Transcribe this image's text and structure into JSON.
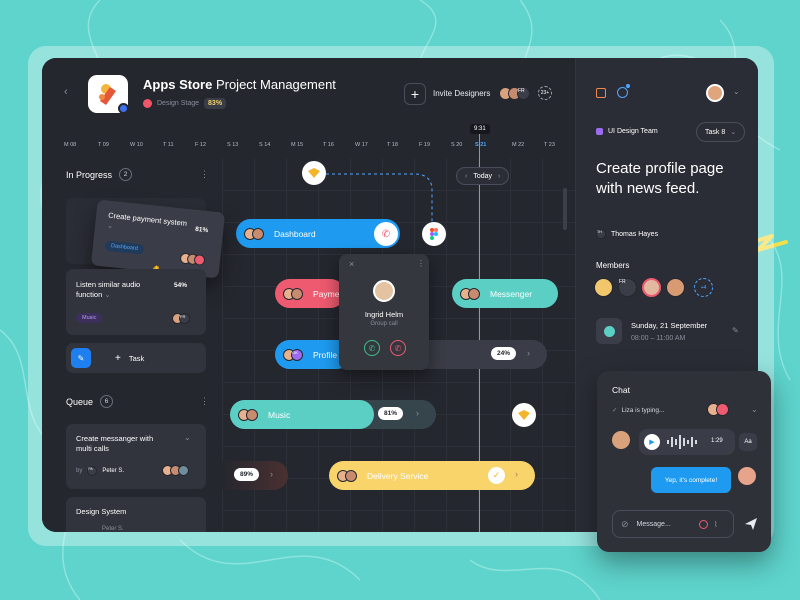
{
  "header": {
    "title_bold": "Apps Store",
    "title_rest": " Project Management",
    "stage_label": "Design Stage",
    "stage_pct": "83%",
    "invite_label": "Invite Designers",
    "invite_initials": "FR",
    "invite_more": "23+"
  },
  "timeline": {
    "days": [
      "M 08",
      "T 09",
      "W 10",
      "T 11",
      "F 12",
      "S 13",
      "S 14",
      "M 15",
      "T 16",
      "W 17",
      "T 18",
      "F 19",
      "S 20",
      "S 21",
      "M 22",
      "T 23"
    ],
    "now_time": "9:31",
    "today_label": "Today"
  },
  "in_progress": {
    "title": "In Progress",
    "count": "2",
    "card1": {
      "title": "Create payment system",
      "tag": "Dashboard",
      "pct": "81%"
    },
    "card2": {
      "title": "Listen similar audio function",
      "tag": "Music",
      "pct": "54%",
      "initials": "FR"
    },
    "task_label": "Task"
  },
  "queue": {
    "title": "Queue",
    "count": "6",
    "card1": {
      "title": "Create messanger with multi calls",
      "by": "by",
      "author": "Peter S.",
      "initials": "PA"
    },
    "card2": {
      "title": "Design System",
      "author": "Peter S."
    }
  },
  "bars": {
    "dashboard": "Dashboard",
    "payment": "Payme",
    "messenger": "Messenger",
    "profile": "Profile",
    "profile_initials": "OK",
    "profile_pct": "24%",
    "music": "Music",
    "music_pct": "81%",
    "delivery": "Delivery Service",
    "left_pct": "89%"
  },
  "call_popup": {
    "name": "Ingrid Helm",
    "subtitle": "Group call"
  },
  "sidebar": {
    "team": "UI Design Team",
    "task": "Task 8",
    "title": "Create profile page with news feed.",
    "author_initials": "TH",
    "author": "Thomas Hayes",
    "members_label": "Members",
    "member_initials": "FR",
    "member_more": "+4",
    "event_date": "Sunday, 21 September",
    "event_time": "08:00 – 11:00 AM"
  },
  "chat": {
    "title": "Chat",
    "typing": "Liza is typing...",
    "voice_duration": "1:29",
    "voice_toggle": "Aa",
    "reply": "Yep, it's complete!",
    "placeholder": "Message..."
  },
  "colors": {
    "background": "#5ed4cc",
    "panel": "#25272f",
    "blue": "#1e9bf0",
    "red": "#ee5a6f",
    "teal": "#5ccfc4",
    "yellow": "#f8d46b",
    "purple": "#9b6cf3"
  }
}
